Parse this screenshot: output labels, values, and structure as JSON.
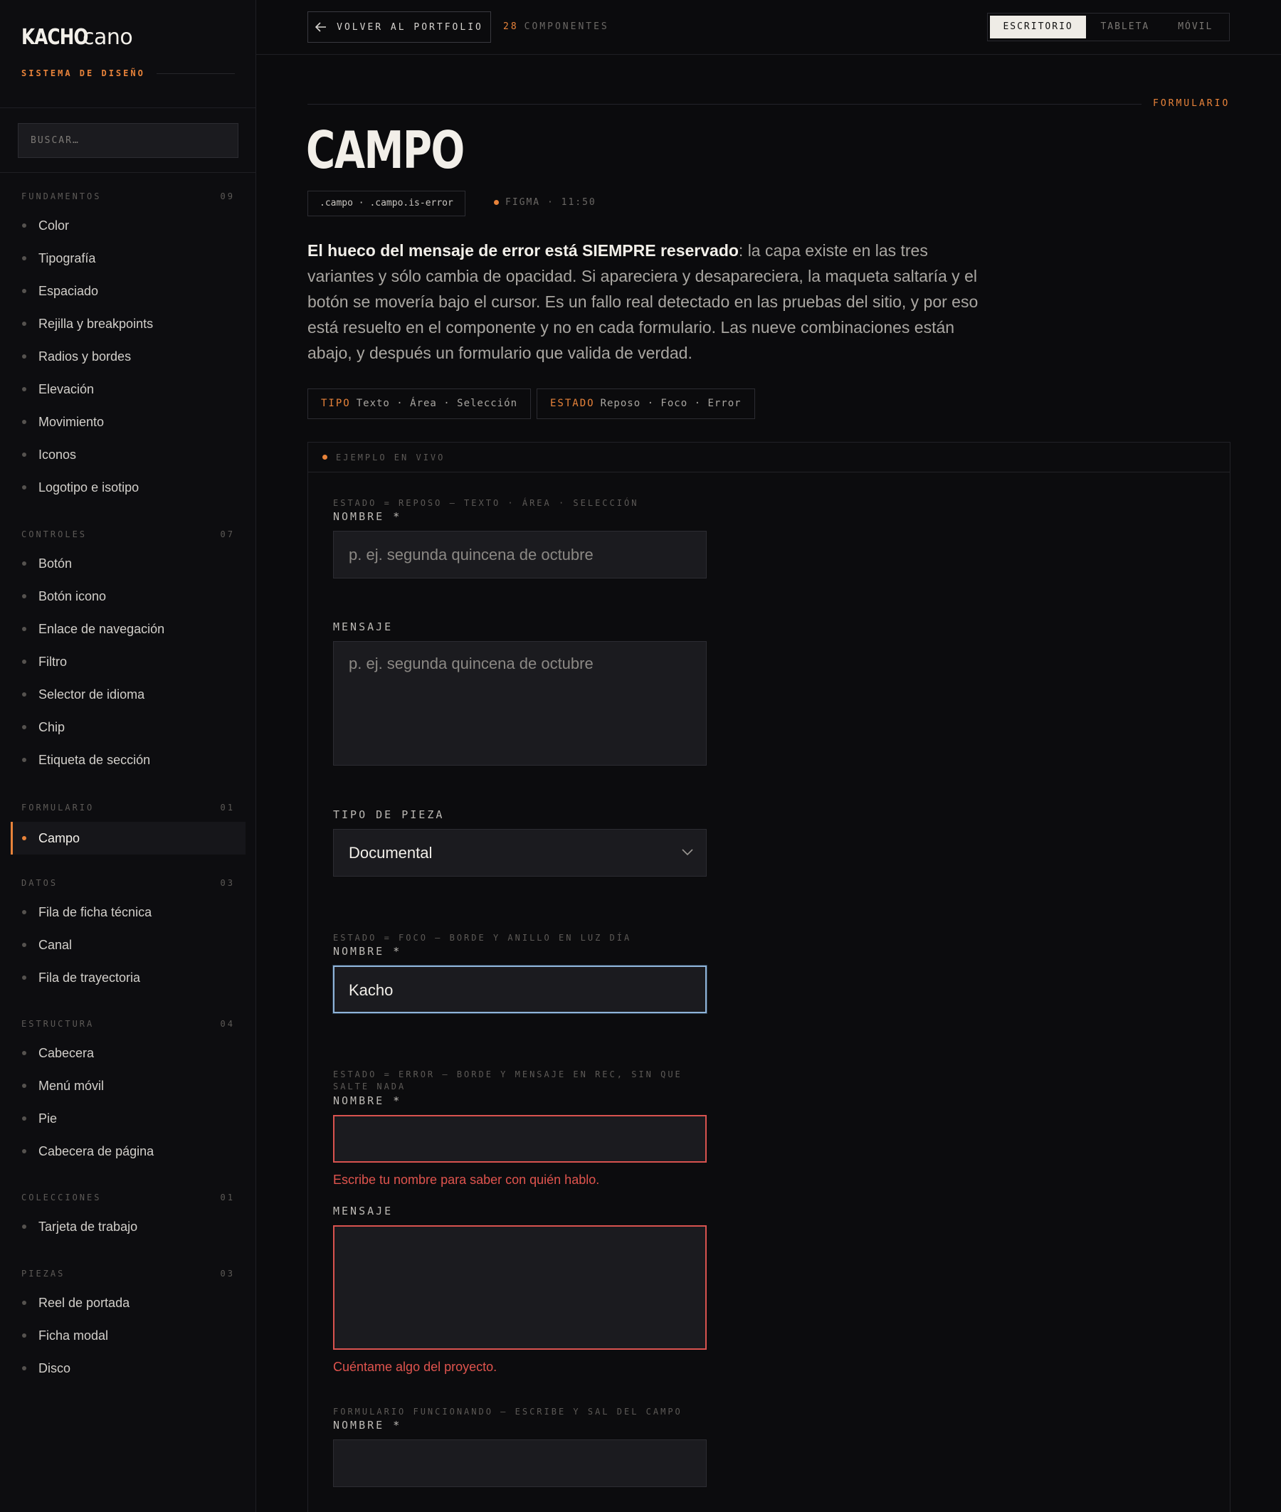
{
  "brand": {
    "logo_bold": "KACHO",
    "logo_light": "cano",
    "subtitle": "SISTEMA DE DISEÑO"
  },
  "search": {
    "placeholder": "BUSCAR…"
  },
  "nav": {
    "groups": [
      {
        "title": "FUNDAMENTOS",
        "count": "09",
        "items": [
          "Color",
          "Tipografía",
          "Espaciado",
          "Rejilla y breakpoints",
          "Radios y bordes",
          "Elevación",
          "Movimiento",
          "Iconos",
          "Logotipo e isotipo"
        ]
      },
      {
        "title": "CONTROLES",
        "count": "07",
        "items": [
          "Botón",
          "Botón icono",
          "Enlace de navegación",
          "Filtro",
          "Selector de idioma",
          "Chip",
          "Etiqueta de sección"
        ]
      },
      {
        "title": "FORMULARIO",
        "count": "01",
        "items": [
          "Campo"
        ]
      },
      {
        "title": "DATOS",
        "count": "03",
        "items": [
          "Fila de ficha técnica",
          "Canal",
          "Fila de trayectoria"
        ]
      },
      {
        "title": "ESTRUCTURA",
        "count": "04",
        "items": [
          "Cabecera",
          "Menú móvil",
          "Pie",
          "Cabecera de página"
        ]
      },
      {
        "title": "COLECCIONES",
        "count": "01",
        "items": [
          "Tarjeta de trabajo"
        ]
      },
      {
        "title": "PIEZAS",
        "count": "03",
        "items": [
          "Reel de portada",
          "Ficha modal",
          "Disco"
        ]
      }
    ],
    "active": "Campo"
  },
  "topbar": {
    "back_label": "VOLVER AL PORTFOLIO",
    "count_num": "28",
    "count_label": "COMPONENTES",
    "viewports": [
      "ESCRITORIO",
      "TABLETA",
      "MÓVIL"
    ],
    "active_viewport": "ESCRITORIO"
  },
  "page": {
    "section": "FORMULARIO",
    "title": "CAMPO",
    "classes": ".campo · .campo.is-error",
    "figma": "FIGMA · 11:50",
    "lead_strong": "El hueco del mensaje de error está SIEMPRE reservado",
    "lead_rest": ": la capa existe en las tres variantes y sólo cambia de opacidad. Si apareciera y desapareciera, la maqueta saltaría y el botón se movería bajo el cursor. Es un fallo real detectado en las pruebas del sitio, y por eso está resuelto en el componente y no en cada formulario. Las nueve combinaciones están abajo, y después un formulario que valida de verdad.",
    "tipo_key": "TIPO",
    "tipo_val": "Texto · Área · Selección",
    "estado_key": "ESTADO",
    "estado_val": "Reposo · Foco · Error"
  },
  "demo": {
    "head": "EJEMPLO EN VIVO",
    "reposo": {
      "caption": "ESTADO = REPOSO — TEXTO · ÁREA · SELECCIÓN",
      "name_label": "NOMBRE *",
      "name_placeholder": "p. ej. segunda quincena de octubre",
      "msg_label": "MENSAJE",
      "msg_placeholder": "p. ej. segunda quincena de octubre",
      "tipo_label": "TIPO DE PIEZA",
      "tipo_value": "Documental"
    },
    "foco": {
      "caption": "ESTADO = FOCO — BORDE Y ANILLO EN LUZ DÍA",
      "name_label": "NOMBRE *",
      "name_value": "Kacho"
    },
    "error": {
      "caption": "ESTADO = ERROR — BORDE Y MENSAJE EN REC, SIN QUE SALTE NADA",
      "name_label": "NOMBRE *",
      "name_error": "Escribe tu nombre para saber con quién hablo.",
      "msg_label": "MENSAJE",
      "msg_error": "Cuéntame algo del proyecto."
    },
    "live": {
      "caption": "FORMULARIO FUNCIONANDO — ESCRIBE Y SAL DEL CAMPO",
      "name_label": "NOMBRE *"
    }
  },
  "colors": {
    "accent": "#e8833a",
    "focus": "#8fb4d9",
    "error": "#e0544e",
    "background": "#0b0b0d"
  }
}
